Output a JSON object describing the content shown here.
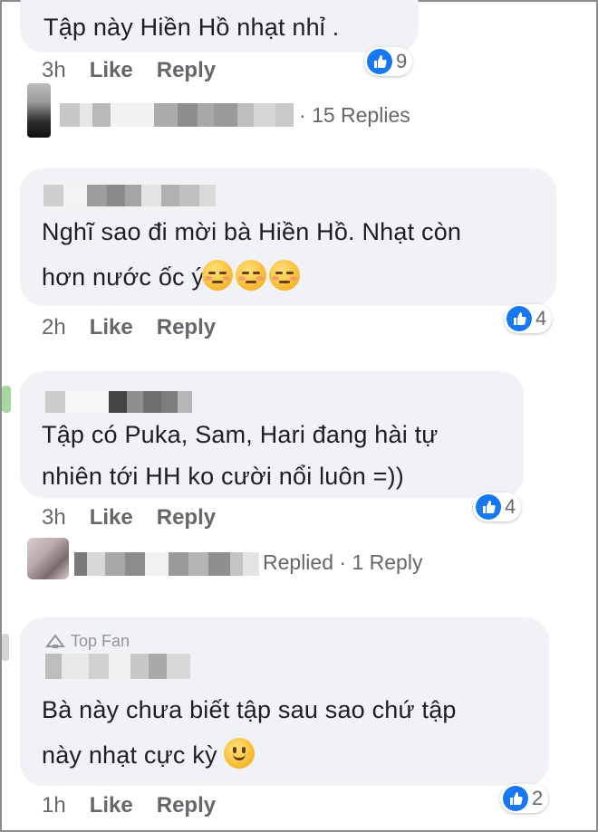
{
  "comments": [
    {
      "text_lines": [
        "Tập  này Hiền Hồ nhạt nhỉ ."
      ],
      "time": "3h",
      "like_label": "Like",
      "reply_label": "Reply",
      "reaction_count": "9"
    },
    {
      "text_lines": [
        "Nghĩ sao đi mời bà Hiền Hồ. Nhạt còn",
        "hơn nước ốc ý"
      ],
      "time": "2h",
      "like_label": "Like",
      "reply_label": "Reply",
      "reaction_count": "4"
    },
    {
      "text_lines": [
        "Tập có Puka, Sam, Hari đang hài tự",
        "nhiên tới HH ko cười nổi luôn =))"
      ],
      "time": "3h",
      "like_label": "Like",
      "reply_label": "Reply",
      "reaction_count": "4"
    },
    {
      "badge": "Top Fan",
      "text_lines": [
        "Bà này chưa biết tập sau sao chứ tập",
        "này nhạt cực kỳ"
      ],
      "time": "1h",
      "like_label": "Like",
      "reply_label": "Reply",
      "reaction_count": "2"
    }
  ],
  "reply_threads": [
    {
      "label": "15 Replies"
    },
    {
      "replied": "Replied",
      "label": "1 Reply"
    }
  ],
  "icons": {
    "reaction": "thumbs-up-icon",
    "emoji_unamused": "unamused-face-icon",
    "emoji_smile": "slightly-smiling-face-icon",
    "top_fan": "top-fan-badge-icon"
  },
  "colors": {
    "like_blue": "#1877f2",
    "bubble": "#f0f2f5",
    "meta_grey": "#65676b"
  }
}
